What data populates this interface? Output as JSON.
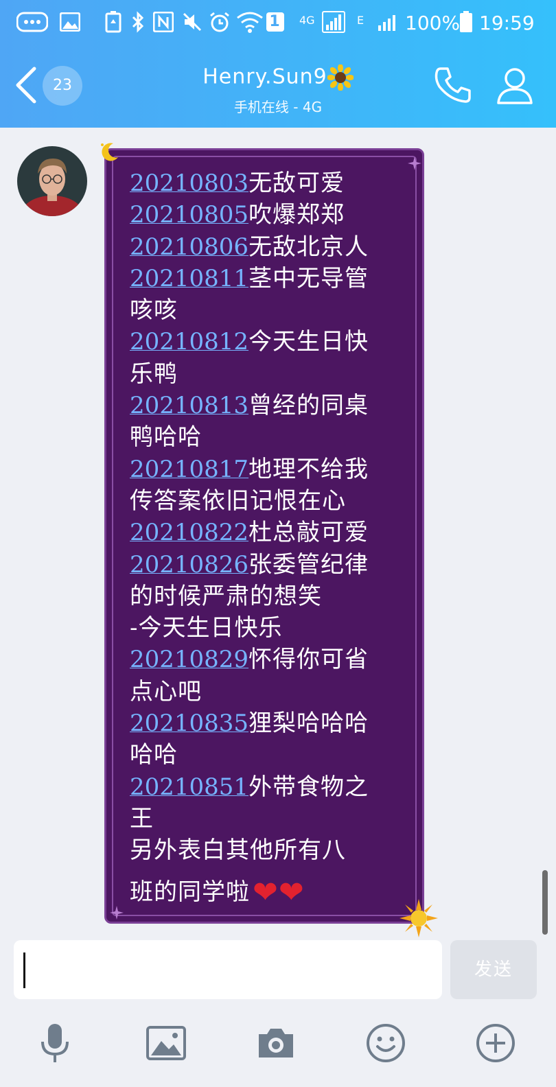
{
  "status_bar": {
    "sim_slot": "1",
    "network_4g": "4G",
    "network_e": "E",
    "battery": "100%",
    "time": "19:59"
  },
  "header": {
    "unread_count": "23",
    "contact_name": "Henry.Sun9",
    "status": "手机在线 - 4G"
  },
  "message": {
    "lines": [
      {
        "date": "20210803",
        "text": "无敌可爱"
      },
      {
        "date": "20210805",
        "text": "吹爆郑郑"
      },
      {
        "date": "20210806",
        "text": "无敌北京人"
      },
      {
        "date": "20210811",
        "text": "茎中无导管"
      },
      {
        "date": "",
        "text": "咳咳"
      },
      {
        "date": "20210812",
        "text": "今天生日快"
      },
      {
        "date": "",
        "text": "乐鸭"
      },
      {
        "date": "20210813",
        "text": "曾经的同桌"
      },
      {
        "date": "",
        "text": "鸭哈哈"
      },
      {
        "date": "20210817",
        "text": "地理不给我"
      },
      {
        "date": "",
        "text": "传答案依旧记恨在心"
      },
      {
        "date": "20210822",
        "text": "杜总敲可爱"
      },
      {
        "date": "20210826",
        "text": "张委管纪律"
      },
      {
        "date": "",
        "text": "的时候严肃的想笑"
      },
      {
        "date": "",
        "text": "-今天生日快乐"
      },
      {
        "date": "20210829",
        "text": "怀得你可省"
      },
      {
        "date": "",
        "text": "点心吧"
      },
      {
        "date": "20210835",
        "text": "狸梨哈哈哈"
      },
      {
        "date": "",
        "text": "哈哈"
      },
      {
        "date": "20210851",
        "text": "外带食物之"
      },
      {
        "date": "",
        "text": "王"
      },
      {
        "date": "",
        "text": "另外表白其他所有八"
      },
      {
        "date": "",
        "text": "班的同学啦",
        "hearts": "❤❤"
      }
    ]
  },
  "composer": {
    "input_value": "",
    "send_label": "发送"
  },
  "toolbar": {
    "icons": [
      "microphone-icon",
      "image-icon",
      "camera-icon",
      "emoji-icon",
      "plus-icon"
    ]
  },
  "colors": {
    "header_start": "#4fa6f5",
    "header_end": "#35c0fb",
    "bubble_bg": "#4c1661",
    "date_link": "#76b4ff",
    "heart": "#e3222f"
  }
}
